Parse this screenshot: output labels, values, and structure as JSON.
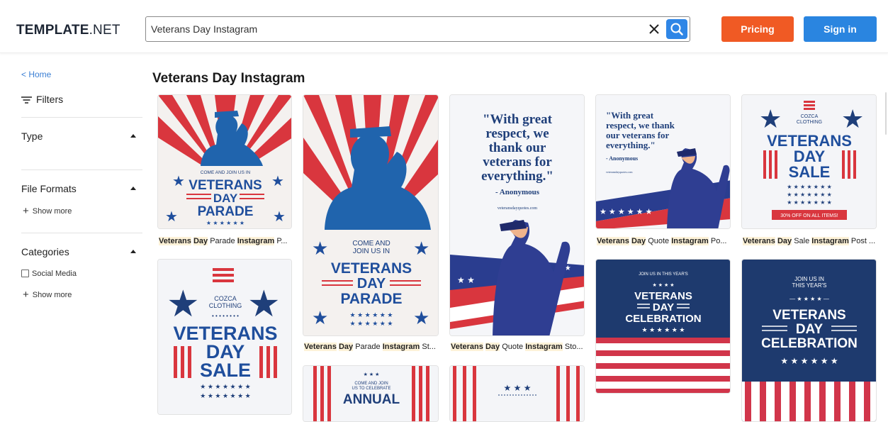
{
  "header": {
    "logo_bold": "TEMPLATE",
    "logo_thin": ".NET",
    "search_value": "Veterans Day Instagram",
    "pricing_label": "Pricing",
    "signin_label": "Sign in"
  },
  "sidebar": {
    "home_link": "< Home",
    "filters_label": "Filters",
    "type_label": "Type",
    "file_formats_label": "File Formats",
    "show_more_label": "Show more",
    "categories_label": "Categories",
    "social_media_label": "Social Media"
  },
  "main": {
    "title": "Veterans Day Instagram",
    "captions": {
      "c1": [
        "Veterans",
        "Day",
        "Parade",
        "Instagram",
        "P..."
      ],
      "c2": [
        "Veterans",
        "Day",
        "Parade",
        "Instagram",
        "St..."
      ],
      "c3": [
        "Veterans",
        "Day",
        "Quote",
        "Instagram",
        "Sto..."
      ],
      "c4": [
        "Veterans",
        "Day",
        "Quote",
        "Instagram",
        "Po..."
      ],
      "c5": [
        "Veterans",
        "Day",
        "Sale",
        "Instagram",
        "Post ..."
      ]
    },
    "card_texts": {
      "parade_small": "COME AND JOIN US IN",
      "come_and": "COME AND",
      "join_us_in": "JOIN US IN",
      "veterans": "VETERANS",
      "day": "DAY",
      "parade": "PARADE",
      "quote_line1": "\"With great",
      "quote_line2": "respect, we",
      "quote_line3": "thank our",
      "quote_line4": "veterans for",
      "quote_line5": "everything.\"",
      "quote_author": "- Anonymous",
      "quote_site": "veteransdayquotes.com",
      "quote2_line1": "\"With great",
      "quote2_line2": "respect, we thank",
      "quote2_line3": "our veterans for",
      "quote2_line4": "everything.\"",
      "cozca1": "COZCA",
      "cozca2": "CLOTHING",
      "sale": "SALE",
      "sale_offer": "30% OFF ON ALL ITEMS!",
      "join_this_year": "JOIN US IN THIS YEAR'S",
      "join_us_in2": "JOIN US IN",
      "this_years": "THIS YEAR'S",
      "celebration": "CELEBRATION",
      "come_join_celebrate1": "COME AND JOIN",
      "come_join_celebrate2": "US TO CELEBRATE",
      "annual": "ANNUAL"
    }
  },
  "colors": {
    "navy": "#1f3f7a",
    "red": "#d9363e",
    "orange": "#f05a24",
    "blue": "#2a85e0"
  }
}
